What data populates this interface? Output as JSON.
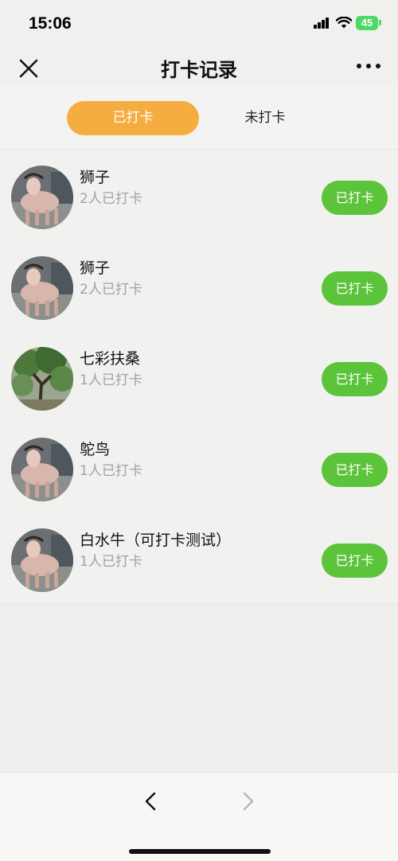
{
  "status_bar": {
    "time": "15:06",
    "battery": "45",
    "icons": [
      "signal-icon",
      "wifi-icon",
      "battery-icon"
    ]
  },
  "nav": {
    "title": "打卡记录",
    "close_icon": "close-icon",
    "more_icon": "more-icon"
  },
  "tabs": [
    {
      "label": "已打卡",
      "active": true
    },
    {
      "label": "未打卡",
      "active": false
    }
  ],
  "records": [
    {
      "name": "狮子",
      "count": "2人已打卡",
      "button": "已打卡",
      "avatar": "white-buffalo-photo"
    },
    {
      "name": "狮子",
      "count": "2人已打卡",
      "button": "已打卡",
      "avatar": "white-buffalo-photo"
    },
    {
      "name": "七彩扶桑",
      "count": "1人已打卡",
      "button": "已打卡",
      "avatar": "tree-photo"
    },
    {
      "name": "鸵鸟",
      "count": "1人已打卡",
      "button": "已打卡",
      "avatar": "white-buffalo-photo"
    },
    {
      "name": "白水牛（可打卡测试）",
      "count": "1人已打卡",
      "button": "已打卡",
      "avatar": "white-buffalo-photo"
    }
  ],
  "toolbar": {
    "back_icon": "chevron-left-icon",
    "forward_icon": "chevron-right-icon"
  },
  "colors": {
    "tab_active": "#f6ad3f",
    "button_green": "#5bc43b",
    "count_gray": "#a2a2a2",
    "background": "#efefed"
  }
}
